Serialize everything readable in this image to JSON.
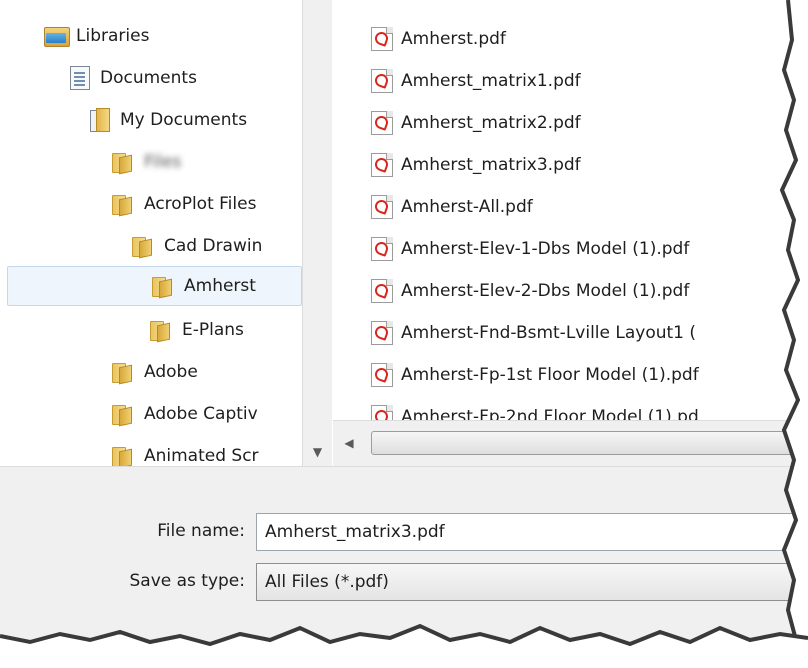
{
  "nav": {
    "items": [
      {
        "label": "Libraries",
        "icon": "libraries-icon",
        "indent": 0
      },
      {
        "label": "Documents",
        "icon": "document-icon",
        "indent": 1
      },
      {
        "label": "My Documents",
        "icon": "my-documents-icon",
        "indent": 2
      },
      {
        "label": "Files",
        "icon": "folder-icon",
        "indent": 3,
        "blurred": true
      },
      {
        "label": "AcroPlot Files",
        "icon": "folder-icon",
        "indent": 3
      },
      {
        "label": "Cad Drawin",
        "icon": "folder-icon",
        "indent": 4
      },
      {
        "label": "Amherst",
        "icon": "folder-icon",
        "indent": 5,
        "selected": true
      },
      {
        "label": "E-Plans",
        "icon": "folder-icon",
        "indent": 4
      },
      {
        "label": "Adobe",
        "icon": "folder-icon",
        "indent": 3
      },
      {
        "label": "Adobe Captiv",
        "icon": "folder-icon",
        "indent": 3
      },
      {
        "label": "Animated Scr",
        "icon": "folder-icon",
        "indent": 3
      }
    ]
  },
  "files": {
    "items": [
      {
        "label": "Amherst.pdf",
        "icon": "pdf-icon"
      },
      {
        "label": "Amherst_matrix1.pdf",
        "icon": "pdf-icon"
      },
      {
        "label": "Amherst_matrix2.pdf",
        "icon": "pdf-icon"
      },
      {
        "label": "Amherst_matrix3.pdf",
        "icon": "pdf-icon"
      },
      {
        "label": "Amherst-All.pdf",
        "icon": "pdf-icon"
      },
      {
        "label": "Amherst-Elev-1-Dbs Model (1).pdf",
        "icon": "pdf-icon"
      },
      {
        "label": "Amherst-Elev-2-Dbs Model (1).pdf",
        "icon": "pdf-icon"
      },
      {
        "label": "Amherst-Fnd-Bsmt-Lville Layout1 (",
        "icon": "pdf-icon"
      },
      {
        "label": "Amherst-Fp-1st Floor Model (1).pdf",
        "icon": "pdf-icon"
      },
      {
        "label": "Amherst-Fp-2nd Floor Model (1).pd",
        "icon": "pdf-icon"
      }
    ]
  },
  "form": {
    "file_name_label": "File name:",
    "file_name_value": "Amherst_matrix3.pdf",
    "save_type_label": "Save as type:",
    "save_type_value": "All Files (*.pdf)"
  },
  "colors": {
    "selection": "#eef5fc",
    "selection_border": "#c4d9ee",
    "pdf_red": "#d9261c",
    "panel": "#f0f0f0"
  }
}
